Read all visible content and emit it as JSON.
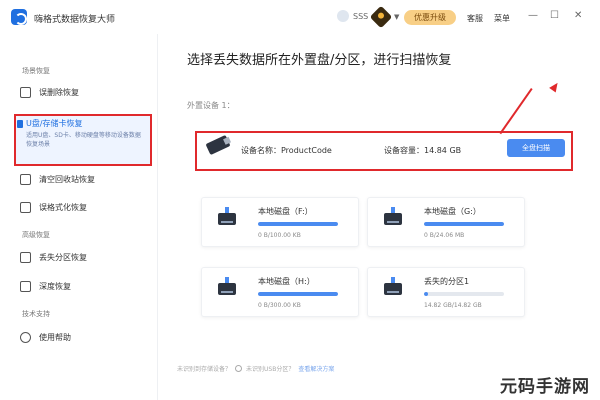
{
  "app": {
    "title": "嗨格式数据恢复大师"
  },
  "topbar": {
    "user_name": "SSS",
    "vip_caret": "▼",
    "upgrade_label": "优惠升级",
    "service_label": "客服",
    "menu_label": "菜单",
    "minimize": "—",
    "maximize": "☐",
    "close": "✕"
  },
  "sidebar": {
    "section_scene": "场景恢复",
    "item_deleted": "误删除恢复",
    "item_usb_title": "U盘/存储卡恢复",
    "item_usb_desc": "适用U盘、SD卡、移动硬盘等移动设备数据恢复场景",
    "item_recycle": "清空回收站恢复",
    "item_format": "误格式化恢复",
    "section_advanced": "高级恢复",
    "item_partition": "丢失分区恢复",
    "item_deep": "深度恢复",
    "section_support": "技术支持",
    "item_help": "使用帮助"
  },
  "main": {
    "heading": "选择丢失数据所在外置盘/分区，进行扫描恢复",
    "external_label": "外置设备 1：",
    "device_name": "设备名称：ProductCode",
    "device_capacity": "设备容量：14.84 GB",
    "scan_button": "全盘扫描",
    "partitions": [
      {
        "name": "本地磁盘（F:）",
        "size": "0 B/100.00 KB",
        "fill": 1.0
      },
      {
        "name": "本地磁盘（G:）",
        "size": "0 B/24.06 MB",
        "fill": 1.0
      },
      {
        "name": "本地磁盘（H:）",
        "size": "0 B/300.00 KB",
        "fill": 1.0
      },
      {
        "name": "丢失的分区1",
        "size": "14.82 GB/14.82 GB",
        "fill": 0.05
      }
    ],
    "footer_text_1": "未识别到存储设备？",
    "footer_text_2": "未识别USB分区？",
    "footer_link": "查看解决方案"
  },
  "watermark": "元码手游网"
}
